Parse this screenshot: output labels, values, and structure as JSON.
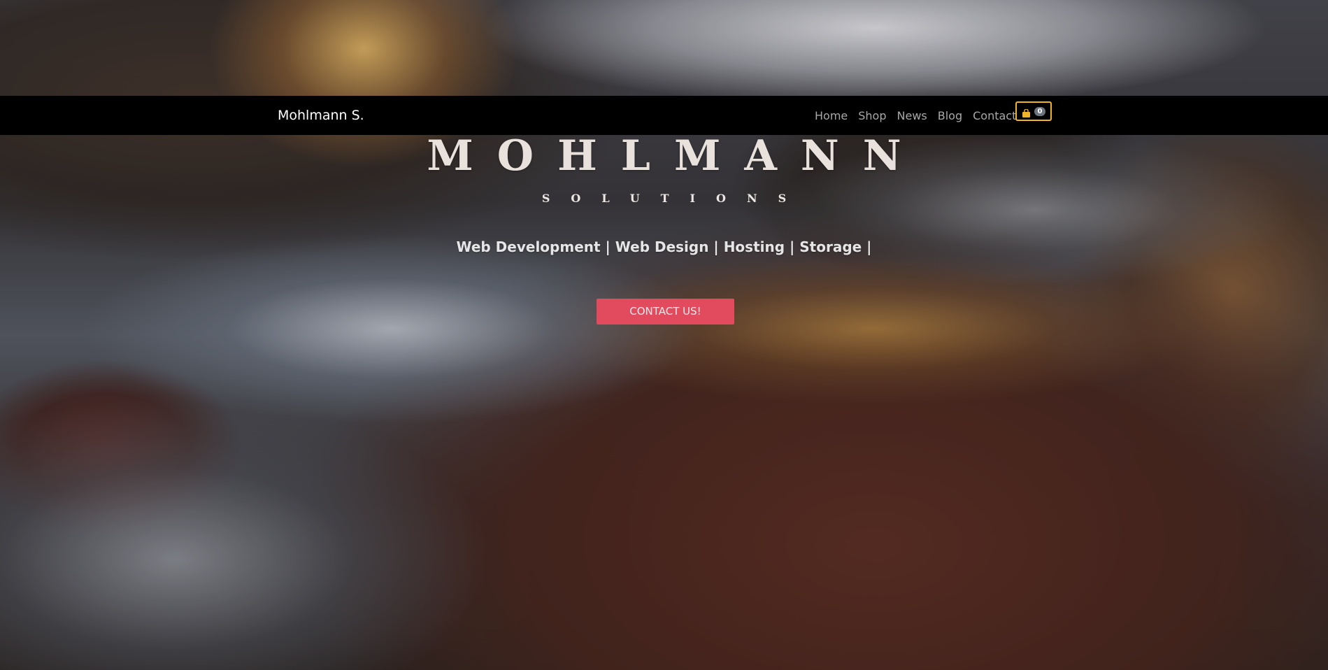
{
  "navbar": {
    "brand": "Mohlmann S.",
    "links": [
      "Home",
      "Shop",
      "News",
      "Blog",
      "Contact"
    ],
    "cart": {
      "icon": "shopping-bag-icon",
      "count": "0",
      "border_color": "#f0b429"
    }
  },
  "hero": {
    "title": "MOHLMANN",
    "subtitle": "SOLUTIONS",
    "tagline": "Web Development | Web Design | Hosting | Storage |",
    "cta_label": "CONTACT US!",
    "cta_color": "#e24a5e"
  }
}
